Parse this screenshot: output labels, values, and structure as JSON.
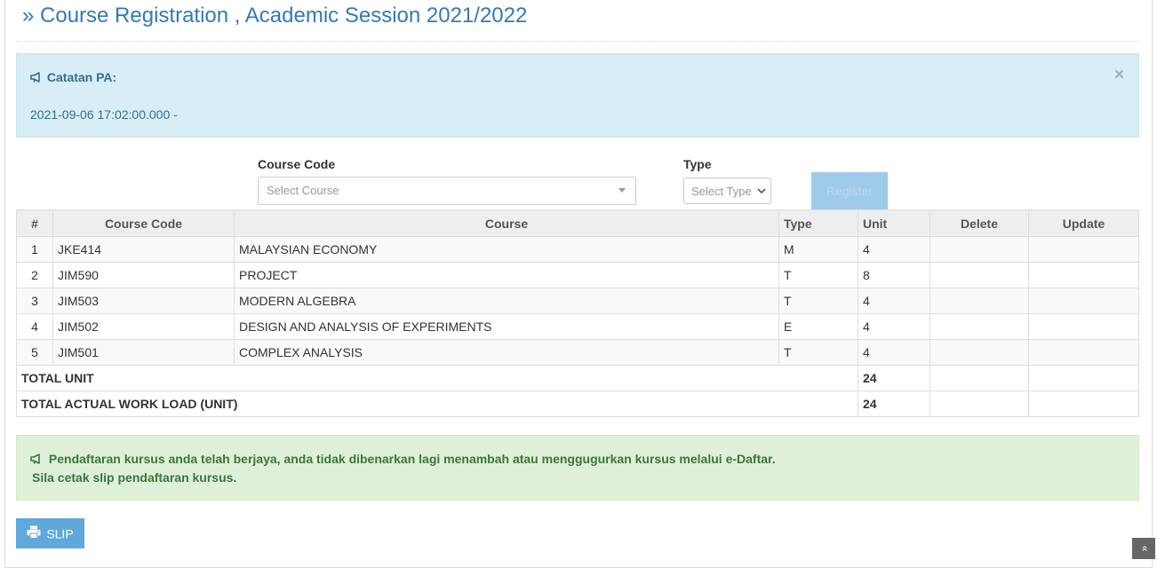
{
  "page": {
    "title": "» Course Registration , Academic Session 2021/2022"
  },
  "info_alert": {
    "icon": "bullhorn-icon",
    "heading": "Catatan PA:",
    "note": "2021-09-06 17:02:00.000 -",
    "close": "×",
    "color": "#31708f",
    "background": "#d9edf7"
  },
  "form": {
    "course_code_label": "Course Code",
    "course_placeholder": "Select Course",
    "type_label": "Type",
    "type_placeholder": "Select Type",
    "register_label": "Register"
  },
  "table": {
    "headers": [
      "#",
      "Course Code",
      "Course",
      "Type",
      "Unit",
      "Delete",
      "Update"
    ],
    "rows": [
      {
        "no": "1",
        "code": "JKE414",
        "course": "MALAYSIAN ECONOMY",
        "type": "M",
        "unit": "4"
      },
      {
        "no": "2",
        "code": "JIM590",
        "course": "PROJECT",
        "type": "T",
        "unit": "8"
      },
      {
        "no": "3",
        "code": "JIM503",
        "course": "MODERN ALGEBRA",
        "type": "T",
        "unit": "4"
      },
      {
        "no": "4",
        "code": "JIM502",
        "course": "DESIGN AND ANALYSIS OF EXPERIMENTS",
        "type": "E",
        "unit": "4"
      },
      {
        "no": "5",
        "code": "JIM501",
        "course": "COMPLEX ANALYSIS",
        "type": "T",
        "unit": "4"
      }
    ],
    "total_unit_label": "TOTAL UNIT",
    "total_unit_value": "24",
    "total_workload_label": "TOTAL ACTUAL WORK LOAD (UNIT)",
    "total_workload_value": "24"
  },
  "success_alert": {
    "icon": "bullhorn-icon",
    "line1": "Pendaftaran kursus anda telah berjaya, anda tidak dibenarkan lagi menambah atau menggugurkan kursus melalui e-Daftar.",
    "line2": "Sila cetak slip pendaftaran kursus.",
    "color": "#3c763d",
    "background": "#dff0d8"
  },
  "slip_button": {
    "icon": "printer-icon",
    "label": "SLIP"
  },
  "scroll_top": {
    "icon": "double-chevron-up-icon",
    "glyph": "»"
  },
  "colors": {
    "accent": "#337ab7",
    "register_disabled": "#9fcbeb",
    "slip_button": "#5fa8dc"
  }
}
